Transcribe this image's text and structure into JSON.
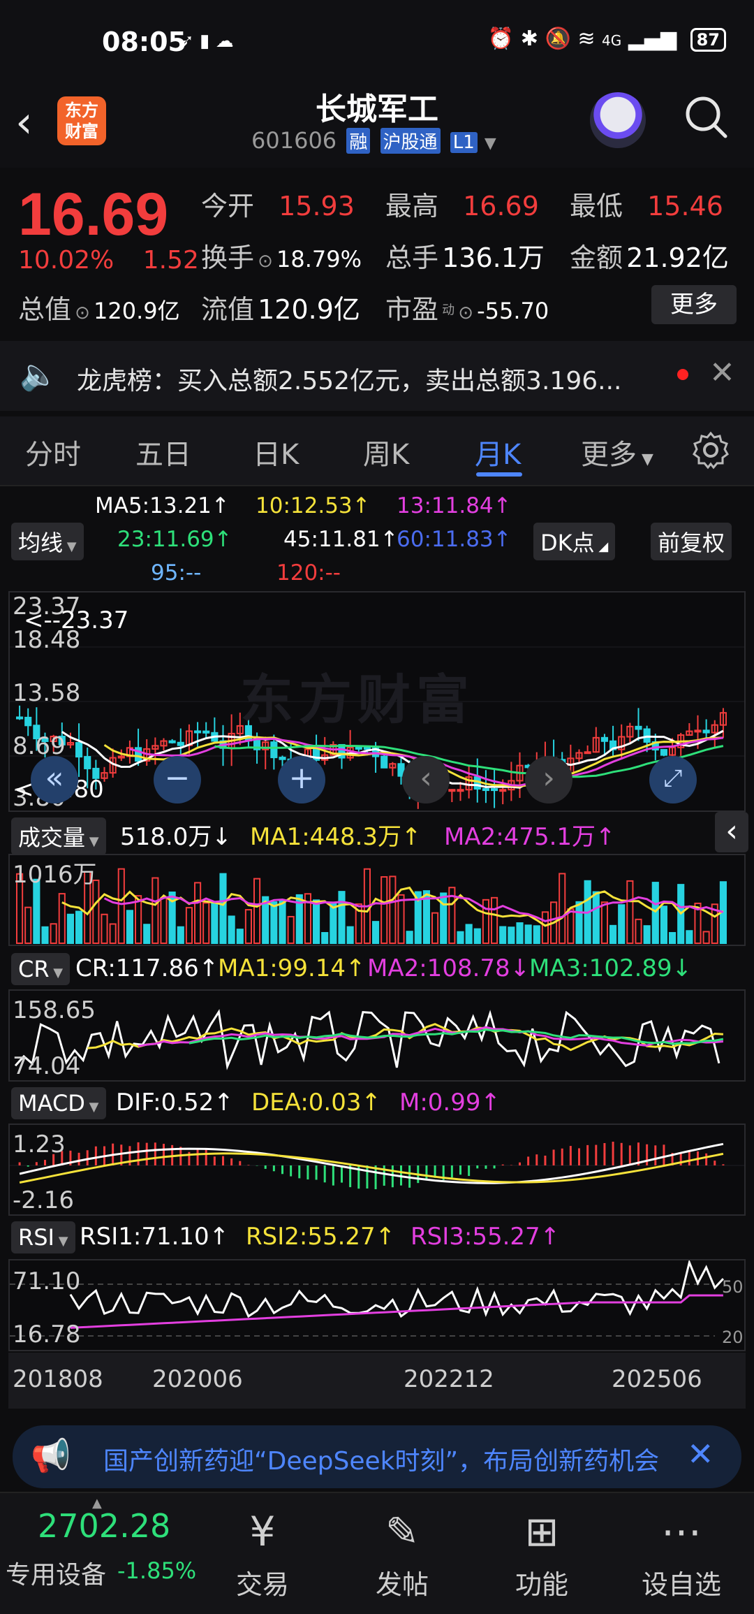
{
  "status_bar": {
    "time": "08:05",
    "battery": "87",
    "network": "4G"
  },
  "header": {
    "brand_logo": "东方\n财富",
    "stock_name": "长城军工",
    "stock_code": "601606",
    "tags": [
      "融",
      "沪股通",
      "L1"
    ]
  },
  "quote": {
    "price": "16.69",
    "change_pct": "10.02%",
    "change_amt": "1.52",
    "open_label": "今开",
    "open": "15.93",
    "high_label": "最高",
    "high": "16.69",
    "low_label": "最低",
    "low": "15.46",
    "turnover_label": "换手",
    "turnover": "18.79%",
    "volume_label": "总手",
    "volume": "136.1万",
    "amount_label": "金额",
    "amount": "21.92亿",
    "mktcap_label": "总值",
    "mktcap": "120.9亿",
    "float_label": "流值",
    "float": "120.9亿",
    "pe_label": "市盈",
    "pe_sup": "动",
    "pe": "-55.70",
    "more": "更多"
  },
  "longhubang": {
    "text": "龙虎榜：买入总额2.552亿元，卖出总额3.196..."
  },
  "tabs": [
    "分时",
    "五日",
    "日K",
    "周K",
    "月K",
    "更多"
  ],
  "active_tab": "月K",
  "kline": {
    "selector": "均线",
    "ma5": "MA5:13.21↑",
    "ma10": "10:12.53↑",
    "ma13": "13:11.84↑",
    "ma23": "23:11.69↑",
    "ma45": "45:11.81↑",
    "ma60": "60:11.83↑",
    "ma95": "95:--",
    "ma120": "120:--",
    "dk_button": "DK点",
    "adjust_button": "前复权",
    "y_max": "23.37",
    "y_2": "18.48",
    "y_3": "13.58",
    "y_4": "8.69",
    "y_min": "3.80",
    "max_marker": "<--23.37",
    "min_marker": "<--3.80",
    "watermark": "东方财富"
  },
  "volume": {
    "selector": "成交量",
    "vol": "518.0万↓",
    "ma1": "MA1:448.3万↑",
    "ma2": "MA2:475.1万↑",
    "y_max": "1016万"
  },
  "cr": {
    "selector": "CR",
    "cr": "CR:117.86↑",
    "ma1": "MA1:99.14↑",
    "ma2": "MA2:108.78↓",
    "ma3": "MA3:102.89↓",
    "y_max": "158.65",
    "y_min": "74.04"
  },
  "macd": {
    "selector": "MACD",
    "dif": "DIF:0.52↑",
    "dea": "DEA:0.03↑",
    "m": "M:0.99↑",
    "y_max": "1.23",
    "y_min": "-2.16"
  },
  "rsi": {
    "selector": "RSI",
    "rsi1": "RSI1:71.10↑",
    "rsi2": "RSI2:55.27↑",
    "rsi3": "RSI3:55.27↑",
    "y_max": "71.10",
    "y_min": "16.78",
    "level_50": "50",
    "level_20": "20"
  },
  "x_axis": [
    "201808",
    "202006",
    "202212",
    "202506"
  ],
  "banner": {
    "text": "国产创新药迎“DeepSeek时刻”，布局创新药机会"
  },
  "bottom_nav": {
    "index_value": "2702.28",
    "sector": "专用设备",
    "sector_change": "-1.85%",
    "items": [
      "交易",
      "发帖",
      "功能",
      "设自选"
    ]
  },
  "colors": {
    "up": "#f23d3d",
    "down": "#27d3e0",
    "accent": "#4e86ff"
  }
}
